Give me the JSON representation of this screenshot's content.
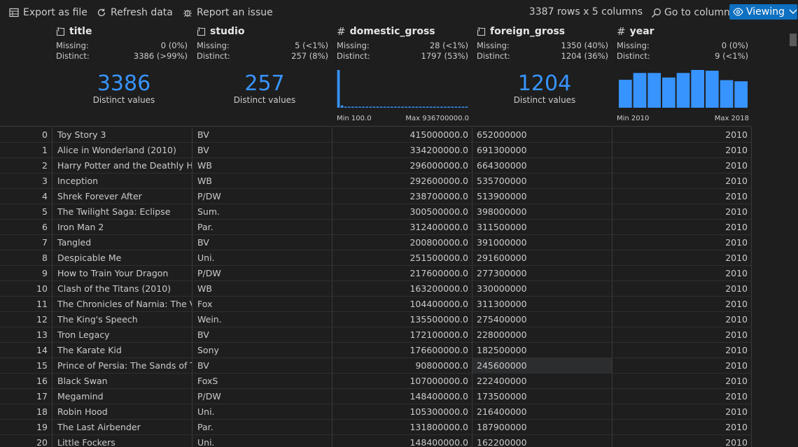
{
  "toolbar": {
    "export_label": "Export as file",
    "refresh_label": "Refresh data",
    "report_label": "Report an issue",
    "rows_info": "3387 rows x 5 columns",
    "goto_label": "Go to column",
    "viewing_label": "Viewing"
  },
  "columns": {
    "title": {
      "name": "title",
      "type_icon": "text-type-icon",
      "missing_key": "Missing:",
      "missing": "0 (0%)",
      "distinct_key": "Distinct:",
      "distinct": "3386 (>99%)",
      "big": "3386",
      "big_sub": "Distinct values"
    },
    "studio": {
      "name": "studio",
      "type_icon": "text-type-icon",
      "missing_key": "Missing:",
      "missing": "5 (<1%)",
      "distinct_key": "Distinct:",
      "distinct": "257 (8%)",
      "big": "257",
      "big_sub": "Distinct values"
    },
    "domestic_gross": {
      "name": "domestic_gross",
      "type_icon": "numeric-type-icon",
      "type_glyph": "#",
      "missing_key": "Missing:",
      "missing": "28 (<1%)",
      "distinct_key": "Distinct:",
      "distinct": "1797 (53%)",
      "hist_min": "Min 100.0",
      "hist_max": "Max 936700000.0",
      "hist_values": [
        1.0,
        0.06,
        0.02,
        0.02,
        0.02,
        0.02,
        0.02,
        0.02,
        0.02,
        0.02,
        0.02,
        0.02,
        0.02,
        0.02,
        0.02,
        0.02,
        0.02,
        0.02,
        0.02,
        0.02,
        0.02,
        0.02,
        0.02,
        0.02,
        0.02,
        0.02,
        0.02,
        0.02,
        0.02,
        0.02,
        0.02,
        0.02,
        0.02,
        0.02,
        0.02,
        0.02,
        0.02
      ]
    },
    "foreign_gross": {
      "name": "foreign_gross",
      "type_icon": "text-type-icon",
      "missing_key": "Missing:",
      "missing": "1350 (40%)",
      "distinct_key": "Distinct:",
      "distinct": "1204 (36%)",
      "big": "1204",
      "big_sub": "Distinct values"
    },
    "year": {
      "name": "year",
      "type_icon": "numeric-type-icon",
      "type_glyph": "#",
      "missing_key": "Missing:",
      "missing": "0 (0%)",
      "distinct_key": "Distinct:",
      "distinct": "9 (<1%)",
      "hist_min": "Min 2010",
      "hist_max": "Max 2018",
      "hist_values": [
        0.74,
        0.92,
        0.92,
        0.8,
        0.92,
        1.0,
        0.98,
        0.73,
        0.7
      ]
    }
  },
  "rows": [
    {
      "idx": "0",
      "title": "Toy Story 3",
      "studio": "BV",
      "domestic_gross": "415000000.0",
      "foreign_gross": "652000000",
      "year": "2010"
    },
    {
      "idx": "1",
      "title": "Alice in Wonderland (2010)",
      "studio": "BV",
      "domestic_gross": "334200000.0",
      "foreign_gross": "691300000",
      "year": "2010"
    },
    {
      "idx": "2",
      "title": "Harry Potter and the Deathly Hallows",
      "studio": "WB",
      "domestic_gross": "296000000.0",
      "foreign_gross": "664300000",
      "year": "2010"
    },
    {
      "idx": "3",
      "title": "Inception",
      "studio": "WB",
      "domestic_gross": "292600000.0",
      "foreign_gross": "535700000",
      "year": "2010"
    },
    {
      "idx": "4",
      "title": "Shrek Forever After",
      "studio": "P/DW",
      "domestic_gross": "238700000.0",
      "foreign_gross": "513900000",
      "year": "2010"
    },
    {
      "idx": "5",
      "title": "The Twilight Saga: Eclipse",
      "studio": "Sum.",
      "domestic_gross": "300500000.0",
      "foreign_gross": "398000000",
      "year": "2010"
    },
    {
      "idx": "6",
      "title": "Iron Man 2",
      "studio": "Par.",
      "domestic_gross": "312400000.0",
      "foreign_gross": "311500000",
      "year": "2010"
    },
    {
      "idx": "7",
      "title": "Tangled",
      "studio": "BV",
      "domestic_gross": "200800000.0",
      "foreign_gross": "391000000",
      "year": "2010"
    },
    {
      "idx": "8",
      "title": "Despicable Me",
      "studio": "Uni.",
      "domestic_gross": "251500000.0",
      "foreign_gross": "291600000",
      "year": "2010"
    },
    {
      "idx": "9",
      "title": "How to Train Your Dragon",
      "studio": "P/DW",
      "domestic_gross": "217600000.0",
      "foreign_gross": "277300000",
      "year": "2010"
    },
    {
      "idx": "10",
      "title": "Clash of the Titans (2010)",
      "studio": "WB",
      "domestic_gross": "163200000.0",
      "foreign_gross": "330000000",
      "year": "2010"
    },
    {
      "idx": "11",
      "title": "The Chronicles of Narnia: The Voyage",
      "studio": "Fox",
      "domestic_gross": "104400000.0",
      "foreign_gross": "311300000",
      "year": "2010"
    },
    {
      "idx": "12",
      "title": "The King's Speech",
      "studio": "Wein.",
      "domestic_gross": "135500000.0",
      "foreign_gross": "275400000",
      "year": "2010"
    },
    {
      "idx": "13",
      "title": "Tron Legacy",
      "studio": "BV",
      "domestic_gross": "172100000.0",
      "foreign_gross": "228000000",
      "year": "2010"
    },
    {
      "idx": "14",
      "title": "The Karate Kid",
      "studio": "Sony",
      "domestic_gross": "176600000.0",
      "foreign_gross": "182500000",
      "year": "2010"
    },
    {
      "idx": "15",
      "title": "Prince of Persia: The Sands of Time",
      "studio": "BV",
      "domestic_gross": "90800000.0",
      "foreign_gross": "245600000",
      "year": "2010"
    },
    {
      "idx": "16",
      "title": "Black Swan",
      "studio": "FoxS",
      "domestic_gross": "107000000.0",
      "foreign_gross": "222400000",
      "year": "2010"
    },
    {
      "idx": "17",
      "title": "Megamind",
      "studio": "P/DW",
      "domestic_gross": "148400000.0",
      "foreign_gross": "173500000",
      "year": "2010"
    },
    {
      "idx": "18",
      "title": "Robin Hood",
      "studio": "Uni.",
      "domestic_gross": "105300000.0",
      "foreign_gross": "216400000",
      "year": "2010"
    },
    {
      "idx": "19",
      "title": "The Last Airbender",
      "studio": "Par.",
      "domestic_gross": "131800000.0",
      "foreign_gross": "187900000",
      "year": "2010"
    },
    {
      "idx": "20",
      "title": "Little Fockers",
      "studio": "Uni.",
      "domestic_gross": "148400000.0",
      "foreign_gross": "162200000",
      "year": "2010"
    }
  ],
  "selected_cell": {
    "row": 15,
    "column": "foreign_gross"
  },
  "colors": {
    "accent": "#3794ff",
    "viewing_bg": "#0e70c0",
    "background": "#1e1e1e"
  }
}
